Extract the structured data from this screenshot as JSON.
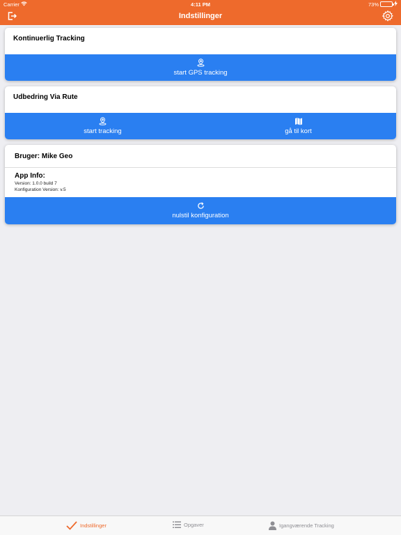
{
  "status_bar": {
    "carrier": "Carrier",
    "time": "4:11 PM",
    "battery": "73%",
    "battery_level": 0.73
  },
  "nav": {
    "title": "Indstillinger",
    "left_icon": "logout-icon",
    "right_icon": "gear-icon"
  },
  "cards": {
    "tracking": {
      "title": "Kontinuerlig Tracking",
      "action": {
        "label": "start GPS tracking",
        "icon": "location-pin-icon"
      }
    },
    "route": {
      "title": "Udbedring Via Rute",
      "actions": [
        {
          "label": "start tracking",
          "icon": "location-pin-icon"
        },
        {
          "label": "gå til kort",
          "icon": "map-icon"
        }
      ]
    },
    "user": {
      "title": "Bruger: Mike Geo",
      "app_info_heading": "App Info:",
      "version": "Version: 1.0.0 build 7",
      "config_version": "Konfiguration Version: v.5",
      "action": {
        "label": "nulstil konfiguration",
        "icon": "refresh-icon"
      }
    }
  },
  "tabs": [
    {
      "label": "Indstillinger",
      "icon": "checkmark-icon",
      "active": true
    },
    {
      "label": "Opgaver",
      "icon": "list-icon",
      "active": false
    },
    {
      "label": "Igangværende Tracking",
      "icon": "person-icon",
      "active": false
    }
  ],
  "colors": {
    "primary_orange": "#ee6a2c",
    "action_blue": "#2a7ff1",
    "background": "#eeeef2"
  }
}
